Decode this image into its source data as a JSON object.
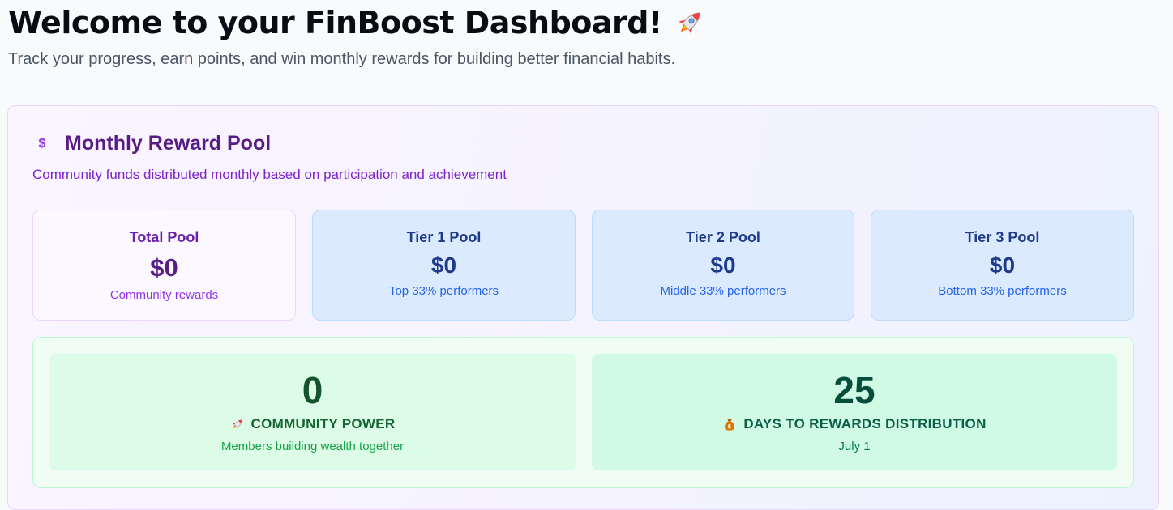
{
  "header": {
    "title": "Welcome to your FinBoost Dashboard!",
    "title_icon": "rocket-icon",
    "subtitle": "Track your progress, earn points, and win monthly rewards for building better financial habits."
  },
  "reward_pool": {
    "icon": "dollar-icon",
    "icon_glyph": "$",
    "title": "Monthly Reward Pool",
    "description": "Community funds distributed monthly based on participation and achievement",
    "total": {
      "label": "Total Pool",
      "value": "$0",
      "note": "Community rewards"
    },
    "tiers": [
      {
        "label": "Tier 1 Pool",
        "value": "$0",
        "note": "Top 33% performers"
      },
      {
        "label": "Tier 2 Pool",
        "value": "$0",
        "note": "Middle 33% performers"
      },
      {
        "label": "Tier 3 Pool",
        "value": "$0",
        "note": "Bottom 33% performers"
      }
    ]
  },
  "community": {
    "power": {
      "value": "0",
      "icon": "rocket-icon",
      "label": "COMMUNITY POWER",
      "note": "Members building wealth together"
    },
    "distribution": {
      "value": "25",
      "icon": "money-bag-icon",
      "label": "DAYS TO REWARDS DISTRIBUTION",
      "note": "July 1"
    }
  },
  "colors": {
    "accent_purple": "#581c87",
    "accent_blue": "#1e3a8a",
    "accent_green": "#166534"
  }
}
